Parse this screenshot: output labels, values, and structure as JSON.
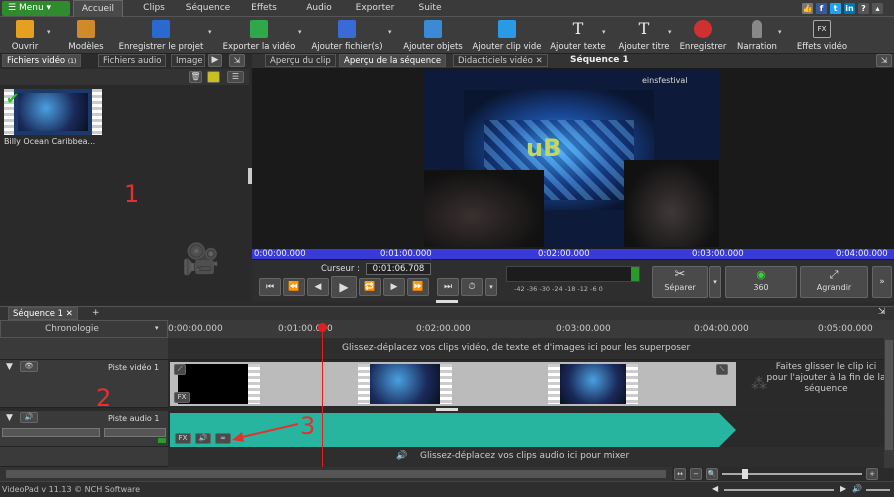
{
  "menu": {
    "menu_label": "Menu",
    "tabs": [
      "Accueil",
      "Clips",
      "Séquence",
      "Effets",
      "Audio",
      "Exporter",
      "Suite"
    ]
  },
  "toolbar": {
    "items": [
      "Ouvrir",
      "Modèles",
      "Enregistrer le projet",
      "Exporter la vidéo",
      "Ajouter fichier(s)",
      "Ajouter objets",
      "Ajouter clip vide",
      "Ajouter texte",
      "Ajouter titre",
      "Enregistrer",
      "Narration",
      "Effets vidéo"
    ]
  },
  "left_tabs": [
    "Fichiers vidéo",
    "Fichiers audio",
    "Image"
  ],
  "left_tab_badge": "(1)",
  "clip": {
    "name": "Billy Ocean Caribbea..."
  },
  "preview_tabs": [
    "Aperçu du clip",
    "Aperçu de la séquence",
    "Didacticiels vidéo"
  ],
  "sequence_title": "Séquence 1",
  "video_watermark": "einsfestival",
  "video_logo": "uB",
  "preview_ruler": [
    "0:00:00.000",
    "0:01:00.000",
    "0:02:00.000",
    "0:03:00.000",
    "0:04:00.000"
  ],
  "cursor": {
    "label": "Curseur :",
    "value": "0:01:06.708"
  },
  "level_scale": "-42 -36 -30 -24 -18 -12 -6 0",
  "actions": {
    "split": "Séparer",
    "360": "360",
    "enlarge": "Agrandir"
  },
  "timeline": {
    "tab": "Séquence 1",
    "chronology": "Chronologie",
    "ruler": [
      "0:00:00.000",
      "0:01:00.000",
      "0:02:00.000",
      "0:03:00.000",
      "0:04:00.000",
      "0:05:00.000"
    ],
    "overlay_hint": "Glissez-déplacez vos clips vidéo, de texte et d'images ici pour les superposer",
    "video_track": "Piste vidéo 1",
    "audio_track": "Piste audio 1",
    "drop_hint": "Faites glisser le clip ici pour l'ajouter à la fin de la séquence",
    "audio_hint": "Glissez-déplacez vos clips audio ici pour mixer"
  },
  "annotations": {
    "a1": "1",
    "a2": "2",
    "a3": "3"
  },
  "status": "VideoPad v 11.13 © NCH Software",
  "colors": {
    "accent_green": "#2e8b2e",
    "audio": "#27b5a0",
    "playhead": "#e02020",
    "annotation": "#e53030",
    "ruler_blue": "#3a3ad8"
  }
}
